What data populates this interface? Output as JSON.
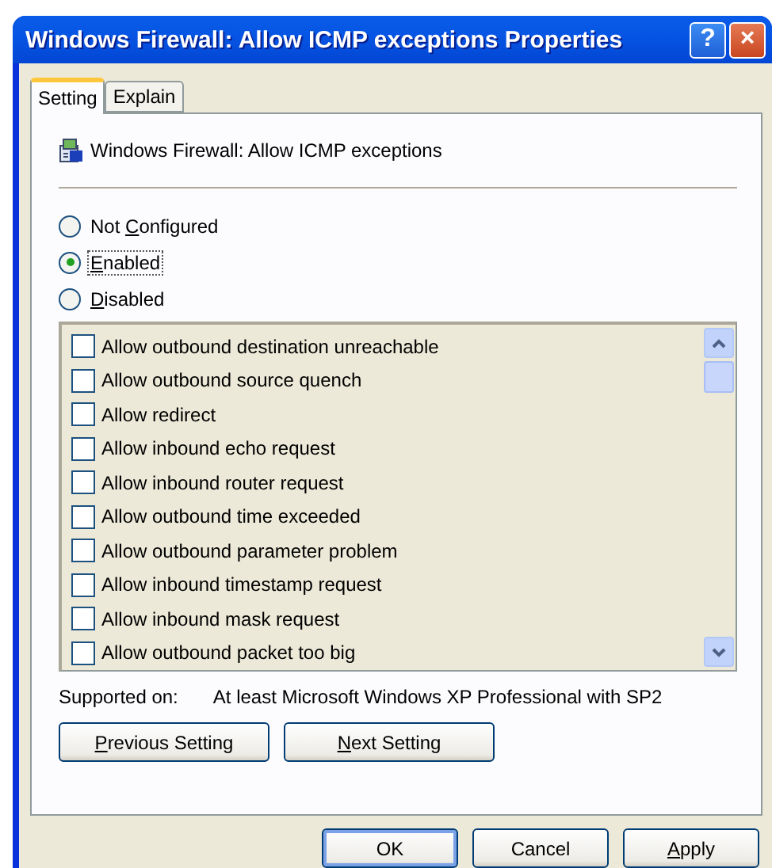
{
  "window": {
    "title": "Windows Firewall: Allow ICMP exceptions Properties",
    "help_button": "?",
    "close_button": "×"
  },
  "tabs": [
    {
      "label": "Setting",
      "selected": true
    },
    {
      "label": "Explain",
      "selected": false
    }
  ],
  "policy": {
    "name": "Windows Firewall: Allow ICMP exceptions"
  },
  "options": [
    {
      "label": {
        "before": "Not ",
        "key": "C",
        "after": "onfigured"
      },
      "selected": false
    },
    {
      "label": {
        "key": "E",
        "after": "nabled"
      },
      "selected": true
    },
    {
      "label": {
        "key": "D",
        "after": "isabled"
      },
      "selected": false
    }
  ],
  "exceptions": [
    {
      "label": "Allow outbound destination unreachable",
      "checked": false
    },
    {
      "label": "Allow outbound source quench",
      "checked": false
    },
    {
      "label": "Allow redirect",
      "checked": false
    },
    {
      "label": "Allow inbound echo request",
      "checked": false
    },
    {
      "label": "Allow inbound router request",
      "checked": false
    },
    {
      "label": "Allow outbound time exceeded",
      "checked": false
    },
    {
      "label": "Allow outbound parameter problem",
      "checked": false
    },
    {
      "label": "Allow inbound timestamp request",
      "checked": false
    },
    {
      "label": "Allow inbound mask request",
      "checked": false
    },
    {
      "label": "Allow outbound packet too big",
      "checked": false
    }
  ],
  "supported_on": {
    "label": "Supported on:",
    "value": "At least Microsoft Windows XP Professional with SP2"
  },
  "nav_buttons": [
    {
      "key": "P",
      "after": "revious Setting"
    },
    {
      "key": "N",
      "after": "ext Setting"
    }
  ],
  "dialog_buttons": [
    {
      "after": "OK",
      "default": true
    },
    {
      "after": "Cancel",
      "default": false
    },
    {
      "key": "A",
      "after": "pply",
      "default": false
    }
  ]
}
